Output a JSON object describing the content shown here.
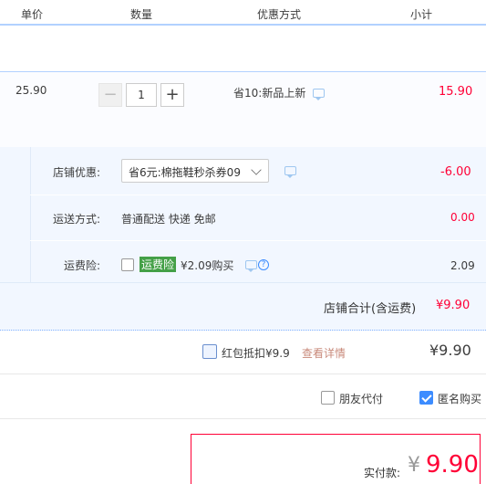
{
  "header": {
    "col_price": "单价",
    "col_qty": "数量",
    "col_promo": "优惠方式",
    "col_subtotal": "小计"
  },
  "item": {
    "price": "25.90",
    "qty": "1",
    "minus": "−",
    "plus": "+",
    "promo": "省10:新品上新",
    "subtotal": "15.90"
  },
  "shop": {
    "discount_label": "店铺优惠:",
    "discount_value": "省6元:棉拖鞋秒杀券09",
    "discount_amount": "-6.00",
    "shipping_label": "运送方式:",
    "shipping_value": "普通配送 快递 免邮",
    "shipping_amount": "0.00",
    "insurance_label": "运费险:",
    "insurance_badge": "运费险",
    "insurance_price": "¥2.09购买",
    "insurance_amount": "2.09",
    "help_glyph": "?",
    "total_label": "店铺合计(含运费)",
    "total_value": "¥9.90"
  },
  "redpacket": {
    "label": "红包抵扣¥9.9",
    "link": "查看详情",
    "amount": "¥9.90"
  },
  "options": {
    "friend_pay": "朋友代付",
    "anonymous": "匿名购买",
    "anonymous_checked": true
  },
  "pay": {
    "label": "实付款:",
    "currency": "¥",
    "value": "9.90"
  },
  "colors": {
    "accent": "#3c8cff",
    "price_red": "#ff0036",
    "badge_green": "#44a047"
  }
}
